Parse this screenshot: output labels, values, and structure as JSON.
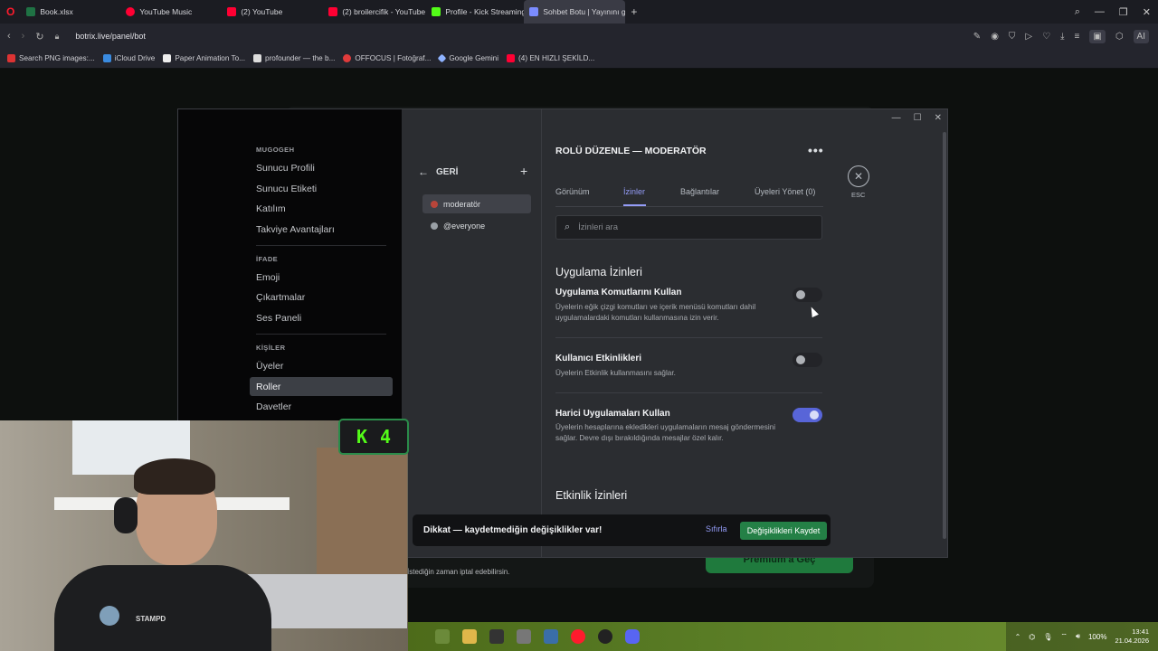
{
  "browser": {
    "tabs": [
      {
        "label": "Book.xlsx",
        "color": "#1f7244",
        "active": false
      },
      {
        "label": "YouTube Music",
        "color": "#ff0033",
        "active": false
      },
      {
        "label": "(2) YouTube",
        "color": "#ff0033",
        "active": false
      },
      {
        "label": "(2) broilercifik - YouTube",
        "color": "#ff0033",
        "active": false
      },
      {
        "label": "Profile - Kick Streaming",
        "color": "#53fc18",
        "active": false
      },
      {
        "label": "Sohbet Botu | Yayınını güç...",
        "color": "#7b8cff",
        "active": true
      }
    ],
    "url": "botrix.live/panel/bot",
    "bookmarks": [
      {
        "label": "Search PNG images:...",
        "color": "#d33"
      },
      {
        "label": "iCloud Drive",
        "color": "#3a8be0"
      },
      {
        "label": "Paper Animation To...",
        "color": "#eee"
      },
      {
        "label": "profounder — the b...",
        "color": "#ddd"
      },
      {
        "label": "OFFOCUS | Fotoğraf...",
        "color": "#e03b3b"
      },
      {
        "label": "Google Gemini",
        "color": "#8fb3ff"
      },
      {
        "label": "(4) EN HIZLI ŞEKİLD...",
        "color": "#ff0033"
      }
    ]
  },
  "sidebar": {
    "sections": [
      {
        "title": "MUGOGEH",
        "items": [
          "Sunucu Profili",
          "Sunucu Etiketi",
          "Katılım",
          "Takviye Avantajları"
        ]
      },
      {
        "title": "İFADE",
        "items": [
          "Emoji",
          "Çıkartmalar",
          "Ses Paneli"
        ]
      },
      {
        "title": "KİŞİLER",
        "items": [
          "Üyeler",
          "Roller",
          "Davetler"
        ]
      }
    ],
    "active_item": "Roller"
  },
  "roles": {
    "back_label": "GERİ",
    "items": [
      {
        "name": "moderatör",
        "color": "#b8453a",
        "active": true
      },
      {
        "name": "@everyone",
        "color": "#9aa0a6",
        "active": false
      }
    ]
  },
  "editor": {
    "title": "ROLÜ DÜZENLE — MODERATÖR",
    "tabs": [
      "Görünüm",
      "İzinler",
      "Bağlantılar",
      "Üyeleri Yönet (0)"
    ],
    "active_tab": "İzinler",
    "search_placeholder": "İzinleri ara",
    "section_app": "Uygulama İzinleri",
    "section_event": "Etkinlik İzinleri",
    "permissions": [
      {
        "title": "Uygulama Komutlarını Kullan",
        "desc": "Üyelerin eğik çizgi komutları ve içerik menüsü komutları dahil uygulamalardaki komutları kullanmasına izin verir.",
        "enabled": false
      },
      {
        "title": "Kullanıcı Etkinlikleri",
        "desc": "Üyelerin Etkinlik kullanmasını sağlar.",
        "enabled": false
      },
      {
        "title": "Harici Uygulamaları Kullan",
        "desc": "Üyelerin hesaplarına ekledikleri uygulamaların mesaj göndermesini sağlar. Devre dışı bırakıldığında mesajlar özel kalır.",
        "enabled": true
      }
    ],
    "esc_label": "ESC"
  },
  "notice": {
    "text": "Dikkat — kaydetmediğin değişiklikler var!",
    "reset_label": "Sıfırla",
    "save_label": "Değişiklikleri Kaydet"
  },
  "background": {
    "button_label": "Premium'a Geç",
    "footer_text": "İstediğin zaman iptal edebilirsin."
  },
  "stream": {
    "badge_letter": "K",
    "badge_count": "4",
    "shirt_text": "STAMPD"
  },
  "taskbar": {
    "battery": "100%",
    "time": "13:41",
    "date": "21.04.2026"
  }
}
